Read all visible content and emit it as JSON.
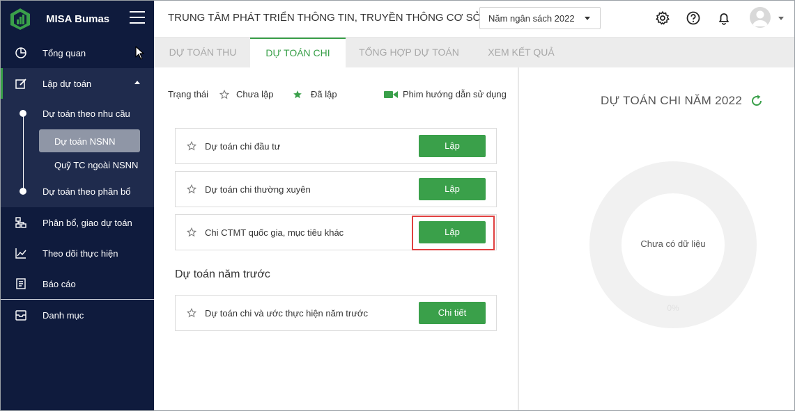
{
  "app": {
    "name": "MISA Bumas"
  },
  "sidebar": {
    "items": [
      {
        "label": "Tổng quan",
        "icon": "pie-chart-icon"
      },
      {
        "label": "Lập dự toán",
        "icon": "edit-icon"
      },
      {
        "label": "Phân bổ, giao dự toán",
        "icon": "hierarchy-icon"
      },
      {
        "label": "Theo dõi thực hiện",
        "icon": "line-chart-icon"
      },
      {
        "label": "Báo cáo",
        "icon": "report-icon"
      },
      {
        "label": "Danh mục",
        "icon": "inbox-icon"
      }
    ],
    "sub_items": [
      {
        "label": "Dự toán theo nhu cầu"
      },
      {
        "label": "Dự toán NSNN"
      },
      {
        "label": "Quỹ TC ngoài NSNN"
      },
      {
        "label": "Dự toán theo phân bổ"
      }
    ]
  },
  "header": {
    "org_title": "TRUNG TÂM PHÁT TRIỂN THÔNG TIN, TRUYỀN THÔNG CƠ SỞ",
    "year_select": "Năm ngân sách 2022"
  },
  "tabs": [
    {
      "label": "DỰ TOÁN THU"
    },
    {
      "label": "DỰ TOÁN CHI"
    },
    {
      "label": "TỔNG HỢP DỰ TOÁN"
    },
    {
      "label": "XEM KẾT QUẢ"
    }
  ],
  "legend": {
    "status_label": "Trạng thái",
    "not_created": "Chưa lập",
    "created": "Đã lập",
    "video_guide": "Phim hướng dẫn sử dụng"
  },
  "cards": [
    {
      "label": "Dự toán chi đầu tư",
      "button": "Lập"
    },
    {
      "label": "Dự toán chi thường xuyên",
      "button": "Lập"
    },
    {
      "label": "Chi CTMT quốc gia, mục tiêu khác",
      "button": "Lập"
    }
  ],
  "previous_year": {
    "title": "Dự toán năm trước",
    "cards": [
      {
        "label": "Dự toán chi và ước thực hiện năm trước",
        "button": "Chi tiết"
      }
    ]
  },
  "right_panel": {
    "title": "DỰ TOÁN CHI NĂM 2022",
    "no_data": "Chưa có dữ liệu",
    "percent": "0%"
  },
  "colors": {
    "sidebar_bg": "#0f1b3d",
    "accent_green": "#3aa04a",
    "highlight_red": "#e04040"
  }
}
